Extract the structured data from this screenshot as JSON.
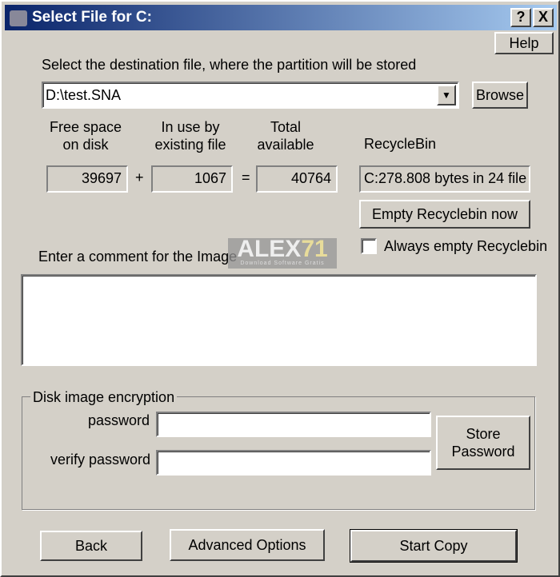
{
  "window": {
    "title": "Select File for C:",
    "help_q": "?",
    "close": "X"
  },
  "help_label": "Help",
  "dest": {
    "label": "Select the destination file, where the partition will be stored",
    "value": "D:\\test.SNA",
    "browse_label": "Browse"
  },
  "space": {
    "free_label": "Free space\non disk",
    "free_value": "39697",
    "inuse_label": "In use by\nexisting file",
    "inuse_value": "1067",
    "total_label": "Total\navailable",
    "total_value": "40764",
    "plus": "+",
    "equals": "="
  },
  "recycle": {
    "label": "RecycleBin",
    "value": "C:278.808 bytes in 24 file",
    "empty_label": "Empty Recyclebin now",
    "always_label": "Always empty Recyclebin",
    "always_checked": false
  },
  "comment": {
    "label": "Enter a comment for the Image",
    "value": ""
  },
  "encryption": {
    "legend": "Disk image encryption",
    "password_label": "password",
    "verify_label": "verify password",
    "password_value": "",
    "verify_value": "",
    "store_label": "Store\nPassword"
  },
  "footer": {
    "back_label": "Back",
    "advanced_label": "Advanced Options",
    "start_label": "Start Copy"
  },
  "watermark": {
    "text": "ALEX",
    "accent": "71",
    "sub": "Download Software Gratis"
  }
}
